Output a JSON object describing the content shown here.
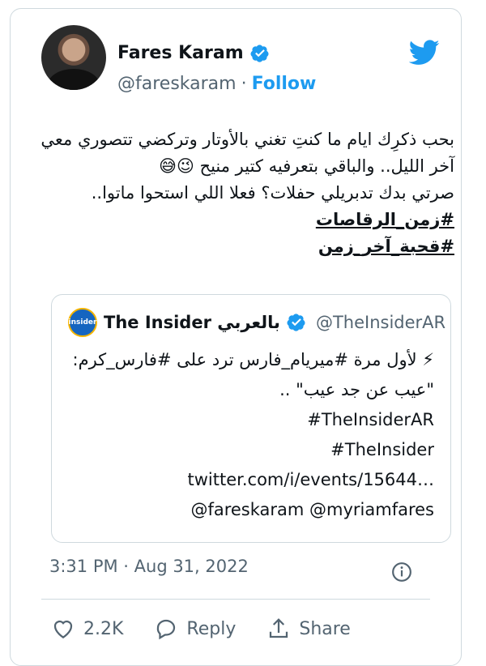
{
  "author": {
    "name": "Fares Karam",
    "handle": "@fareskaram",
    "separator": "·",
    "follow_label": "Follow"
  },
  "tweet": {
    "lines": [
      "بحب ذكرِك ايام ما كنتِ تغني بالأوتار وتركضي تتصوري معي",
      "آخر الليل.. والباقي بتعرفيه كتير منيح 😉😅",
      "صرتي بدك تدبريلي حفلات؟ فعلا اللي استحوا ماتوا.."
    ],
    "hashtags": [
      "#زمن_الرقاصات",
      "#قحبة_آخر_زمن"
    ]
  },
  "quote": {
    "logo_text": "insider",
    "name": "The Insider بالعربي",
    "handle": "@TheInsiderAR",
    "lines": [
      "⚡ لأول مرة #ميريام_فارس ترد على #فارس_كرم:",
      "\"عيب عن جد عيب\" ..",
      "#TheInsiderAR",
      "#TheInsider",
      "twitter.com/i/events/15644…",
      "@fareskaram @myriamfares"
    ]
  },
  "timestamp": "3:31 PM · Aug 31, 2022",
  "actions": {
    "like_count": "2.2K",
    "reply_label": "Reply",
    "share_label": "Share"
  },
  "colors": {
    "accent": "#1d9bf0",
    "muted": "#536471",
    "border": "#cfd9de",
    "text": "#0f1419"
  },
  "icons": [
    "verified-badge-icon",
    "twitter-bird-icon",
    "info-icon",
    "heart-icon",
    "reply-bubble-icon",
    "share-icon"
  ]
}
